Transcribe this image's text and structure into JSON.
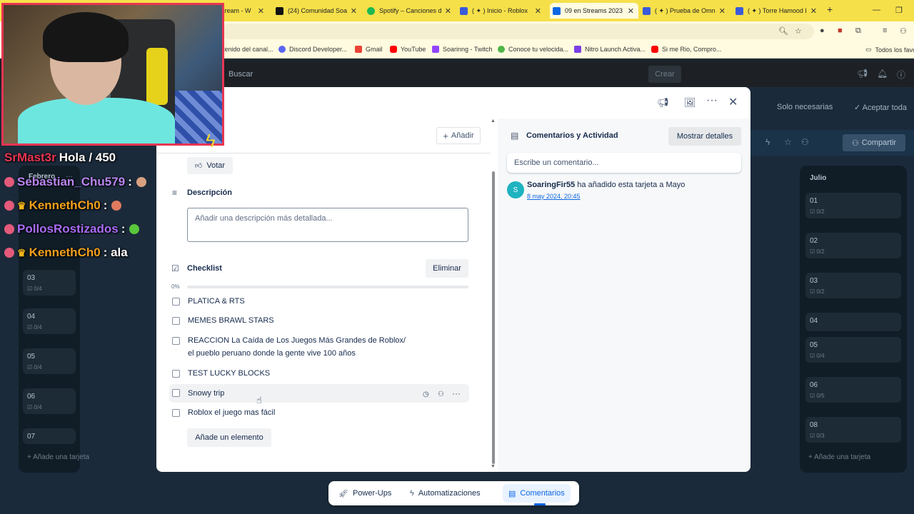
{
  "browser": {
    "tabs": [
      {
        "label": "tream - W",
        "icon": "tab-generic",
        "color": "#888888"
      },
      {
        "label": "(24) Comunidad Soa",
        "icon": "x-logo",
        "color": "#111111"
      },
      {
        "label": "Spotify – Canciones d",
        "icon": "spotify-logo",
        "color": "#1db954"
      },
      {
        "label": "( ✦ ) Inicio - Roblox",
        "icon": "roblox-logo",
        "color": "#3a5bd9"
      },
      {
        "label": "09 en Streams 2023",
        "icon": "trello-logo",
        "color": "#0c66e4"
      },
      {
        "label": "( ✦ ) Prueba de Omn",
        "icon": "roblox-logo",
        "color": "#3a5bd9"
      },
      {
        "label": "( ✦ ) Torre Hamood I",
        "icon": "roblox-logo",
        "color": "#3a5bd9"
      }
    ],
    "bookmarks": [
      {
        "label": "tenido del canal...",
        "color": "#cc3333"
      },
      {
        "label": "Discord Developer...",
        "color": "#5865f2"
      },
      {
        "label": "Gmail",
        "color": "#ea4335"
      },
      {
        "label": "YouTube",
        "color": "#ff0000"
      },
      {
        "label": "Soarinng - Twitch",
        "color": "#9146ff"
      },
      {
        "label": "Conoce tu velocida...",
        "color": "#4fb648"
      },
      {
        "label": "Nitro Launch Activa...",
        "color": "#7b3fe4"
      },
      {
        "label": "Si me Rio, Compro...",
        "color": "#ff0000"
      },
      {
        "label": "Todos los favo",
        "color": "#666666"
      }
    ]
  },
  "trello": {
    "search": "Buscar",
    "create": "Crear",
    "cookie_necessary": "Solo necesarias",
    "cookie_accept": "Aceptar toda",
    "share": "Compartir"
  },
  "overlay": {
    "chat": [
      {
        "user": "SrMast3r",
        "user_color": "#e83552",
        "message": "Hola / 450",
        "badges": []
      },
      {
        "user": "Sebastian_Chu579",
        "user_color": "#b985f0",
        "message": ":",
        "badges": [
          "badge"
        ]
      },
      {
        "user": "KennethCh0",
        "user_color": "#f2a01c",
        "message": ":",
        "badges": [
          "badge",
          "crown"
        ]
      },
      {
        "user": "PollosRostizados",
        "user_color": "#a86cf5",
        "message": ":",
        "badges": [
          "badge"
        ]
      },
      {
        "user": "KennethCh0",
        "user_color": "#f2a01c",
        "message": ": ala",
        "badges": [
          "badge",
          "crown"
        ]
      }
    ]
  },
  "board": {
    "left_list": {
      "title": "Febrero",
      "cards": [
        {
          "title": "03",
          "meta": "0/4"
        },
        {
          "title": "04",
          "meta": "0/4"
        },
        {
          "title": "05",
          "meta": "0/4"
        },
        {
          "title": "06",
          "meta": "0/4"
        },
        {
          "title": "07",
          "meta": ""
        }
      ],
      "add": "Añade una tarjeta"
    },
    "right_list": {
      "title": "Julio",
      "cards": [
        {
          "title": "01",
          "meta": "0/2"
        },
        {
          "title": "02",
          "meta": "0/2"
        },
        {
          "title": "03",
          "meta": "0/2"
        },
        {
          "title": "04",
          "meta": ""
        },
        {
          "title": "05",
          "meta": "0/4"
        },
        {
          "title": "06",
          "meta": "0/5"
        },
        {
          "title": "08",
          "meta": "0/3"
        }
      ],
      "add": "Añade una tarjeta"
    }
  },
  "modal": {
    "add_label": "Añadir",
    "vote_label": "Votar",
    "description": {
      "title": "Descripción",
      "placeholder": "Añadir una descripción más detallada..."
    },
    "checklist": {
      "title": "Checklist",
      "delete_label": "Eliminar",
      "progress_label": "0%",
      "progress": 0,
      "items": [
        {
          "text": "PLATICA & RTS",
          "checked": false
        },
        {
          "text": "MEMES BRAWL STARS",
          "checked": false
        },
        {
          "text": "REACCION La Caída de Los Juegos Más Grandes de Roblox/",
          "text2": "el pueblo peruano donde la gente vive 100 años",
          "checked": false
        },
        {
          "text": "TEST LUCKY BLOCKS",
          "checked": false
        },
        {
          "text": "Snowy trip",
          "checked": false
        },
        {
          "text": "Roblox el juego mas fácil",
          "checked": false
        }
      ],
      "add_item_label": "Añade un elemento"
    },
    "comments": {
      "title": "Comentarios y Actividad",
      "show_details": "Mostrar detalles",
      "input_placeholder": "Escribe un comentario...",
      "activity": {
        "avatar_initial": "S",
        "user": "SoaringFir55",
        "action": " ha añadido esta tarjeta a Mayo",
        "time": "8 may 2024, 20:45"
      }
    }
  },
  "bottombar": {
    "powerups": "Power-Ups",
    "automations": "Automatizaciones",
    "comments": "Comentarios"
  }
}
